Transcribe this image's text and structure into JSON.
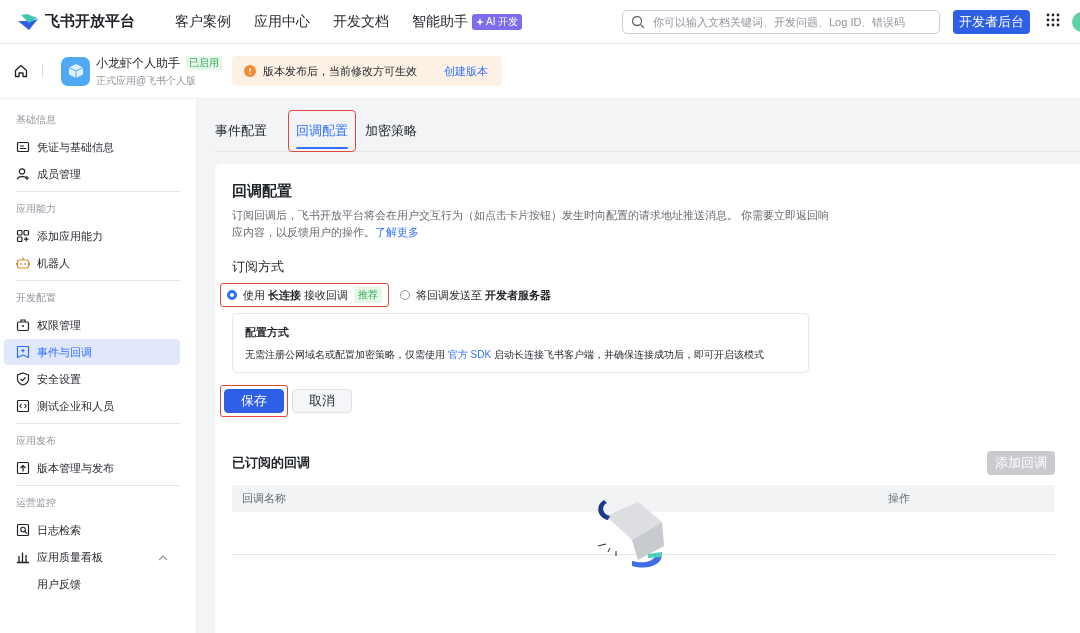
{
  "topbar": {
    "brand": "飞书开放平台",
    "nav": [
      {
        "label": "客户案例"
      },
      {
        "label": "应用中心"
      },
      {
        "label": "开发文档"
      },
      {
        "label": "智能助手",
        "badge": "AI 开发"
      }
    ],
    "search": {
      "placeholder": "你可以输入文档关键词、开发问题、Log ID、错误码"
    },
    "console_button": "开发者后台"
  },
  "app": {
    "name": "小龙虾个人助手",
    "status": "已启用",
    "subtitle": "正式应用@飞书个人版"
  },
  "notice": {
    "text": "版本发布后，当前修改方可生效",
    "link": "创建版本"
  },
  "sidebar": [
    {
      "title": "基础信息",
      "items": [
        {
          "label": "凭证与基础信息",
          "selected": false
        },
        {
          "label": "成员管理",
          "selected": false
        }
      ]
    },
    {
      "title": "应用能力",
      "items": [
        {
          "label": "添加应用能力",
          "selected": false
        },
        {
          "label": "机器人",
          "selected": false
        }
      ]
    },
    {
      "title": "开发配置",
      "items": [
        {
          "label": "权限管理",
          "selected": false
        },
        {
          "label": "事件与回调",
          "selected": true
        },
        {
          "label": "安全设置",
          "selected": false
        },
        {
          "label": "测试企业和人员",
          "selected": false
        }
      ]
    },
    {
      "title": "应用发布",
      "items": [
        {
          "label": "版本管理与发布",
          "selected": false
        }
      ]
    },
    {
      "title": "运营监控",
      "items": [
        {
          "label": "日志检索",
          "selected": false
        },
        {
          "label": "应用质量看板",
          "selected": false,
          "expanded": true,
          "children": [
            {
              "label": "用户反馈",
              "selected": false
            }
          ]
        }
      ]
    }
  ],
  "tabs": [
    {
      "label": "事件配置",
      "selected": false,
      "highlighted": false
    },
    {
      "label": "回调配置",
      "selected": true,
      "highlighted": true
    },
    {
      "label": "加密策略",
      "selected": false,
      "highlighted": false
    }
  ],
  "section": {
    "title": "回调配置",
    "description": "订阅回调后，飞书开放平台将会在用户交互行为（如点击卡片按钮）发生时向配置的请求地址推送消息。 你需要立即返回响应内容，以反馈用户的操作。",
    "learn_more": "了解更多"
  },
  "subscription": {
    "label": "订阅方式",
    "options": [
      {
        "text": "使用 **长连接** 接收回调",
        "tag": "推荐",
        "selected": true,
        "highlighted": true
      },
      {
        "text": "将回调发送至 **开发者服务器**",
        "selected": false,
        "highlighted": false
      }
    ],
    "info": {
      "title": "配置方式",
      "before": "无需注册公网域名或配置加密策略，仅需使用",
      "link": "官方 SDK",
      "after": "启动长连接飞书客户端，并确保连接成功后，即可开启该模式"
    }
  },
  "actions": [
    {
      "label": "保存",
      "kind": "primary",
      "highlighted": true
    },
    {
      "label": "取消",
      "kind": "secondary",
      "highlighted": false
    }
  ],
  "subscribed": {
    "title": "已订阅的回调",
    "add_button": {
      "label": "添加回调",
      "disabled": true
    },
    "columns": [
      "回调名称",
      "操作"
    ]
  }
}
